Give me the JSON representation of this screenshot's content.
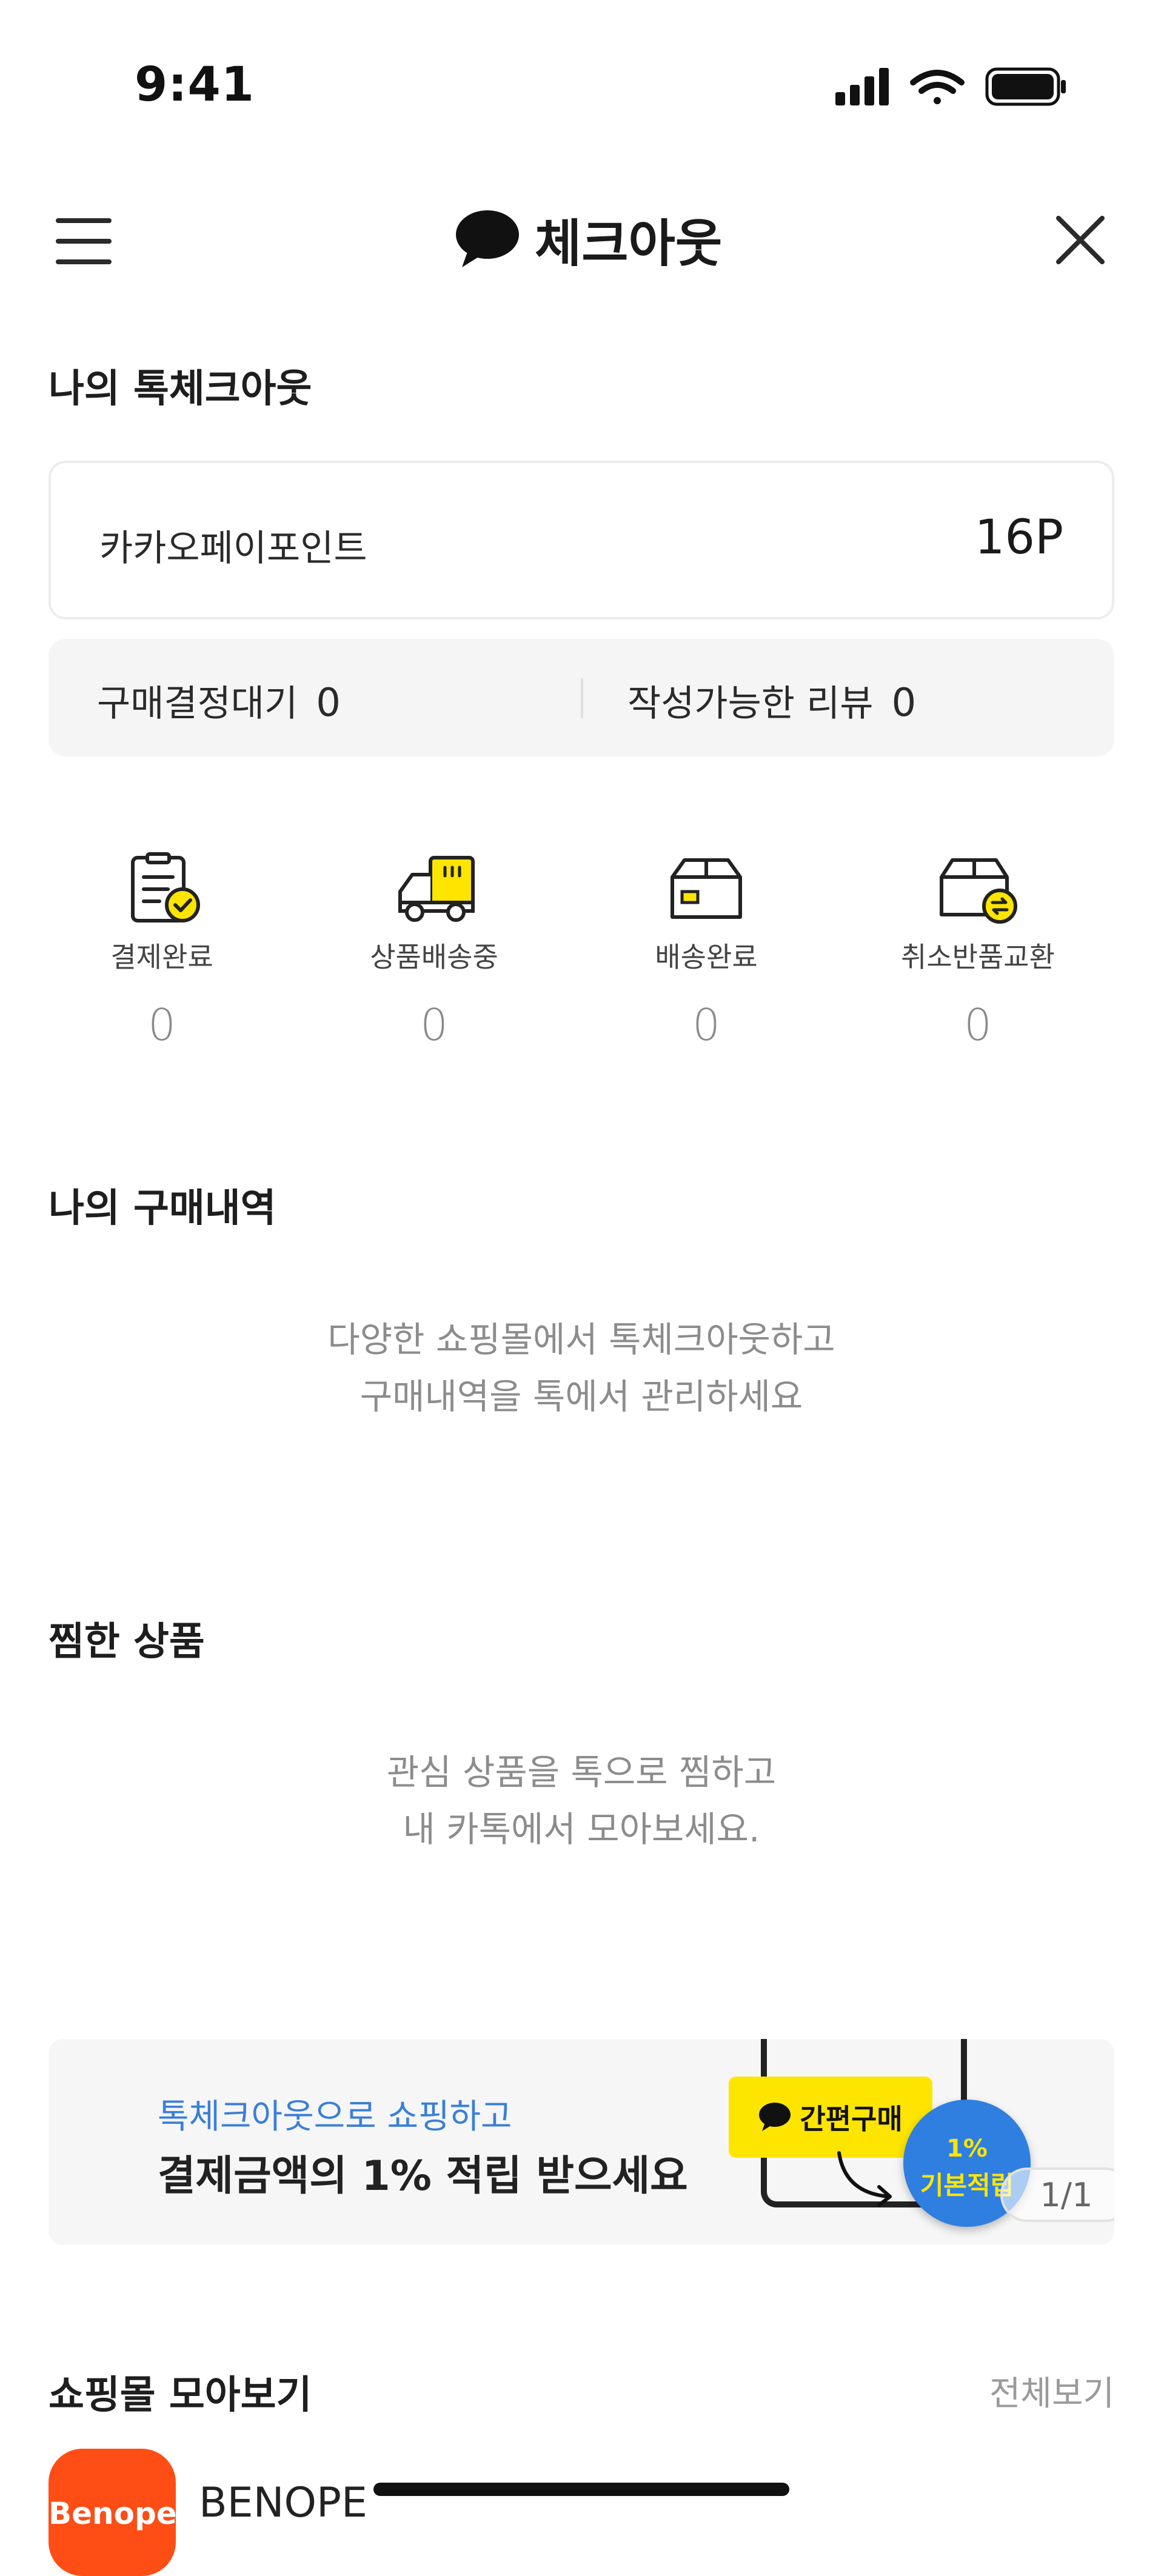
{
  "status_bar": {
    "time": "9:41"
  },
  "header": {
    "title": "체크아웃",
    "icons": [
      "menu-icon",
      "talk-bubble-icon",
      "close-icon"
    ]
  },
  "my_checkout": {
    "title": "나의 톡체크아웃",
    "points": {
      "label": "카카오페이포인트",
      "value": "16P"
    },
    "stats": [
      {
        "label": "구매결정대기",
        "count": "0"
      },
      {
        "label": "작성가능한 리뷰",
        "count": "0"
      }
    ],
    "order_steps": [
      {
        "label": "결제완료",
        "count": "0",
        "icon": "payment-complete-icon"
      },
      {
        "label": "상품배송중",
        "count": "0",
        "icon": "delivery-truck-icon"
      },
      {
        "label": "배송완료",
        "count": "0",
        "icon": "delivered-box-icon"
      },
      {
        "label": "취소반품교환",
        "count": "0",
        "icon": "exchange-box-icon"
      }
    ]
  },
  "purchase_history": {
    "title": "나의 구매내역",
    "empty_lines": [
      "다양한 쇼핑몰에서 톡체크아웃하고",
      "구매내역을 톡에서 관리하세요"
    ]
  },
  "wishlist": {
    "title": "찜한 상품",
    "empty_lines": [
      "관심 상품을 톡으로 찜하고",
      "내 카톡에서 모아보세요."
    ]
  },
  "banner": {
    "line1": "톡체크아웃으로 쇼핑하고",
    "line2": "결제금액의 1% 적립 받으세요",
    "quick_buy": "간편구매",
    "reward_percent": "1%",
    "reward_label": "기본적립",
    "pager": "1/1"
  },
  "shop_collection": {
    "title": "쇼핑몰 모아보기",
    "view_all": "전체보기",
    "shops": [
      {
        "logo_text": "Benope",
        "name": "BENOPE"
      }
    ]
  },
  "colors": {
    "accent_yellow": "#fee500",
    "banner_blue": "#3a7fd8",
    "badge_blue": "#2f7fe0",
    "shop_orange": "#ff4d16"
  }
}
